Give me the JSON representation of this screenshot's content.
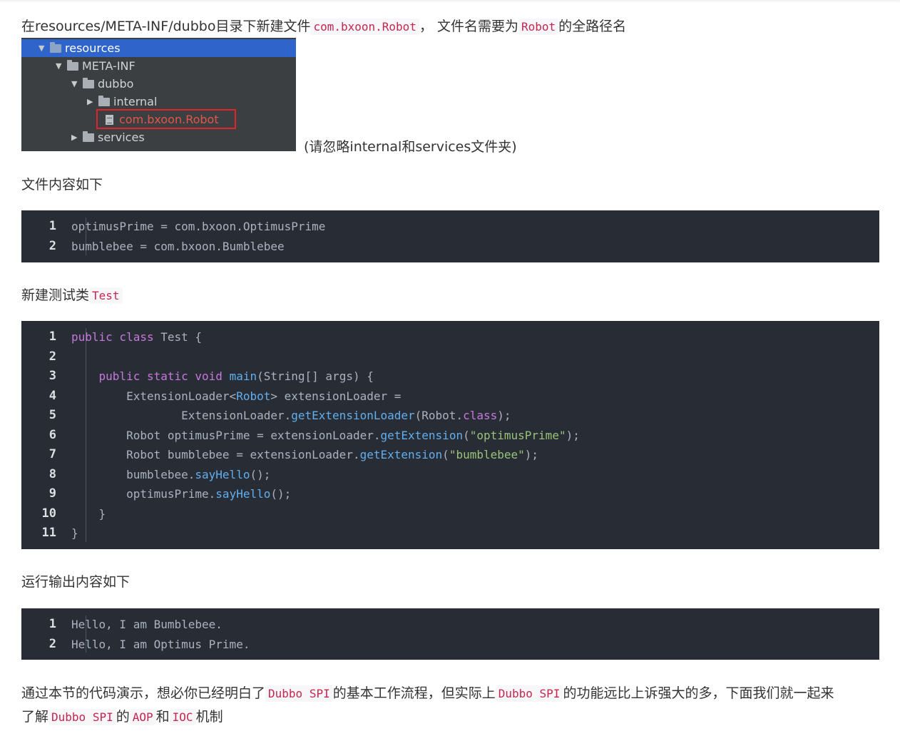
{
  "intro": {
    "text1": "在resources/META-INF/dubbo目录下新建文件",
    "code1": "com.bxoon.Robot",
    "text2": "，  文件名需要为",
    "code2": "Robot",
    "text3": "的全路径名"
  },
  "file_tree": {
    "items": [
      {
        "label": "resources",
        "toggle": "▼",
        "kind": "resource-folder",
        "selected": true
      },
      {
        "label": "META-INF",
        "toggle": "▼",
        "kind": "folder"
      },
      {
        "label": "dubbo",
        "toggle": "▼",
        "kind": "folder"
      },
      {
        "label": "internal",
        "toggle": "▶",
        "kind": "folder"
      },
      {
        "label": "com.bxoon.Robot",
        "toggle": "",
        "kind": "file",
        "highlighted": true
      },
      {
        "label": "services",
        "toggle": "▶",
        "kind": "folder"
      }
    ],
    "note": "(请忽略internal和services文件夹)"
  },
  "section_file_content": {
    "heading": "文件内容如下",
    "lines": [
      {
        "n": "1",
        "text": "optimusPrime = com.bxoon.OptimusPrime"
      },
      {
        "n": "2",
        "text": "bumblebee = com.bxoon.Bumblebee"
      }
    ]
  },
  "section_test": {
    "heading": "新建测试类",
    "code": "Test",
    "lines": [
      {
        "n": "1",
        "tokens": [
          [
            "kw",
            "public class "
          ],
          [
            "pl",
            "Test {"
          ]
        ]
      },
      {
        "n": "2",
        "tokens": []
      },
      {
        "n": "3",
        "tokens": [
          [
            "pl",
            "    "
          ],
          [
            "kw",
            "public static void "
          ],
          [
            "fn",
            "main"
          ],
          [
            "pl",
            "(String[] args) {"
          ]
        ]
      },
      {
        "n": "4",
        "tokens": [
          [
            "pl",
            "        ExtensionLoader<"
          ],
          [
            "fn",
            "Robot"
          ],
          [
            "pl",
            "> extensionLoader ="
          ]
        ]
      },
      {
        "n": "5",
        "tokens": [
          [
            "pl",
            "                ExtensionLoader."
          ],
          [
            "fn",
            "getExtensionLoader"
          ],
          [
            "pl",
            "(Robot."
          ],
          [
            "kw",
            "class"
          ],
          [
            "pl",
            ");"
          ]
        ]
      },
      {
        "n": "6",
        "tokens": [
          [
            "pl",
            "        Robot optimusPrime = extensionLoader."
          ],
          [
            "fn",
            "getExtension"
          ],
          [
            "pl",
            "("
          ],
          [
            "str",
            "\"optimusPrime\""
          ],
          [
            "pl",
            ");"
          ]
        ]
      },
      {
        "n": "7",
        "tokens": [
          [
            "pl",
            "        Robot bumblebee = extensionLoader."
          ],
          [
            "fn",
            "getExtension"
          ],
          [
            "pl",
            "("
          ],
          [
            "str",
            "\"bumblebee\""
          ],
          [
            "pl",
            ");"
          ]
        ]
      },
      {
        "n": "8",
        "tokens": [
          [
            "pl",
            "        bumblebee."
          ],
          [
            "fn",
            "sayHello"
          ],
          [
            "pl",
            "();"
          ]
        ]
      },
      {
        "n": "9",
        "tokens": [
          [
            "pl",
            "        optimusPrime."
          ],
          [
            "fn",
            "sayHello"
          ],
          [
            "pl",
            "();"
          ]
        ]
      },
      {
        "n": "10",
        "tokens": [
          [
            "pl",
            "    }"
          ]
        ]
      },
      {
        "n": "11",
        "tokens": [
          [
            "pl",
            "}"
          ]
        ]
      }
    ]
  },
  "section_output": {
    "heading": "运行输出内容如下",
    "lines": [
      {
        "n": "1",
        "text": "Hello, I am Bumblebee."
      },
      {
        "n": "2",
        "text": "Hello, I am Optimus Prime."
      }
    ]
  },
  "closing": {
    "t1": "通过本节的代码演示，想必你已经明白了",
    "c1": "Dubbo SPI",
    "t2": "的基本工作流程，但实际上",
    "c2": "Dubbo SPI",
    "t3": "的功能远比上诉强大的多，下面我们就一起来",
    "t4": "了解",
    "c3": "Dubbo SPI",
    "t5": "的",
    "c4": "AOP",
    "t6": "和",
    "c5": "IOC",
    "t7": "机制"
  },
  "colors": {
    "code_bg": "#282c34",
    "keyword": "#c678dd",
    "function": "#61afef",
    "string": "#98c379",
    "inline_code": "#c7254e",
    "tree_selected": "#2f65ca",
    "highlight_box": "#e0252a"
  }
}
